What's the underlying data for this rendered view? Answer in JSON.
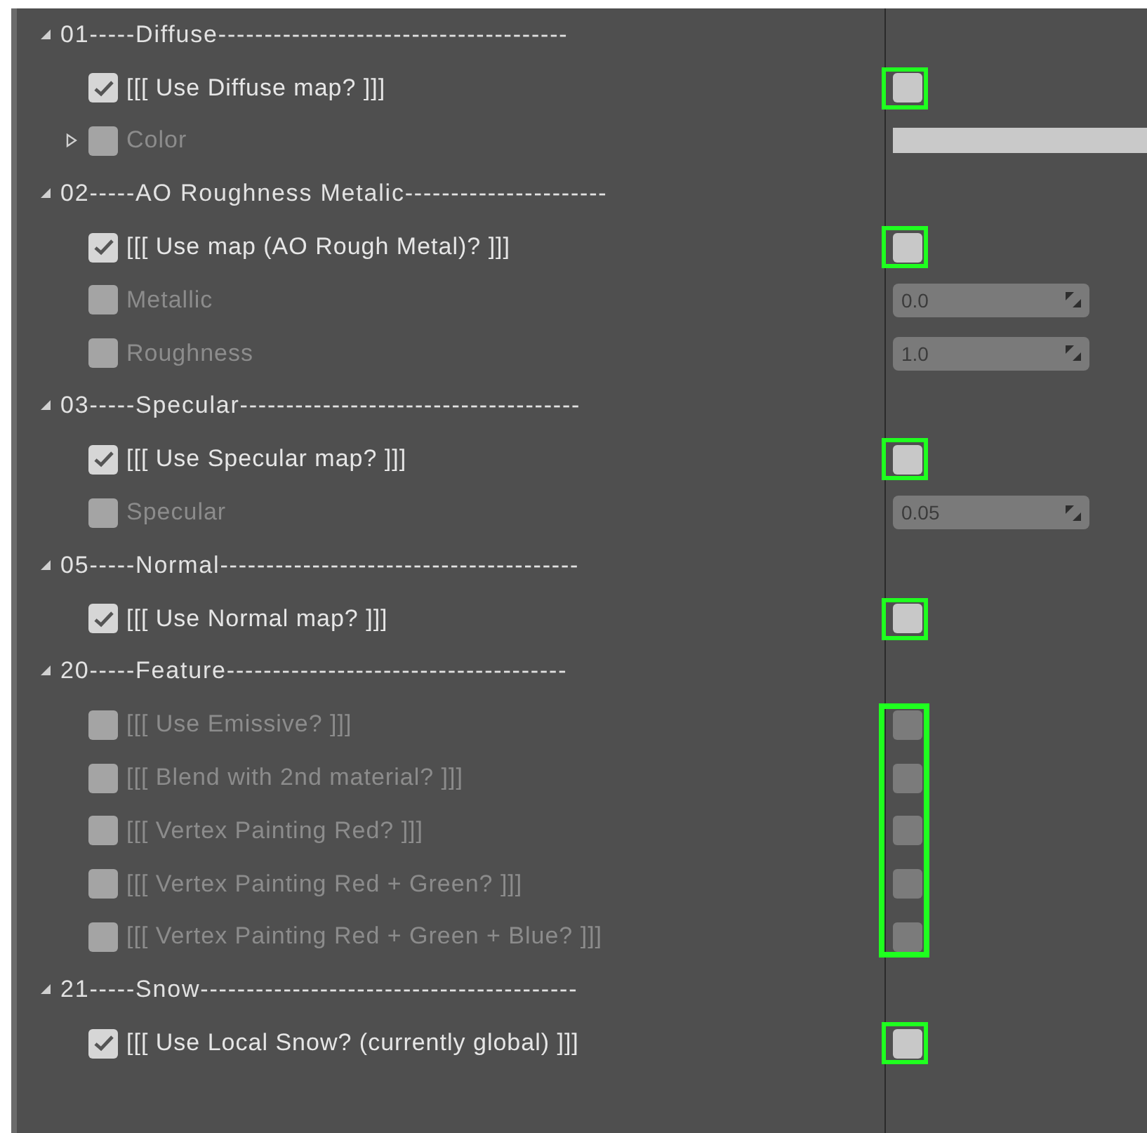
{
  "sections": [
    {
      "title": "01-----Diffuse--------------------------------------",
      "expanded": true,
      "group_highlighted": false,
      "rows": [
        {
          "label": "[[[ Use Diffuse map? ]]]",
          "override": true,
          "expandable": false,
          "control": {
            "kind": "checkbox",
            "checked": false,
            "disabled": false,
            "highlighted": true
          }
        },
        {
          "label": "Color",
          "override": false,
          "expandable": true,
          "expanded": false,
          "control": {
            "kind": "color"
          }
        }
      ]
    },
    {
      "title": "02-----AO Roughness Metalic----------------------",
      "expanded": true,
      "group_highlighted": false,
      "rows": [
        {
          "label": "[[[ Use map (AO Rough Metal)? ]]]",
          "override": true,
          "expandable": false,
          "control": {
            "kind": "checkbox",
            "checked": false,
            "disabled": false,
            "highlighted": true
          }
        },
        {
          "label": "Metallic",
          "override": false,
          "expandable": false,
          "control": {
            "kind": "number",
            "value": "0.0"
          }
        },
        {
          "label": "Roughness",
          "override": false,
          "expandable": false,
          "control": {
            "kind": "number",
            "value": "1.0"
          }
        }
      ]
    },
    {
      "title": "03-----Specular-------------------------------------",
      "expanded": true,
      "group_highlighted": false,
      "rows": [
        {
          "label": "[[[ Use Specular map? ]]]",
          "override": true,
          "expandable": false,
          "control": {
            "kind": "checkbox",
            "checked": false,
            "disabled": false,
            "highlighted": true
          }
        },
        {
          "label": "Specular",
          "override": false,
          "expandable": false,
          "control": {
            "kind": "number",
            "value": "0.05"
          }
        }
      ]
    },
    {
      "title": "05-----Normal---------------------------------------",
      "expanded": true,
      "group_highlighted": false,
      "rows": [
        {
          "label": "[[[ Use Normal map? ]]]",
          "override": true,
          "expandable": false,
          "control": {
            "kind": "checkbox",
            "checked": false,
            "disabled": false,
            "highlighted": true
          }
        }
      ]
    },
    {
      "title": "20-----Feature-------------------------------------",
      "expanded": true,
      "group_highlighted": true,
      "rows": [
        {
          "label": "[[[ Use Emissive? ]]]",
          "override": false,
          "expandable": false,
          "control": {
            "kind": "checkbox",
            "checked": false,
            "disabled": true,
            "highlighted": false
          }
        },
        {
          "label": "[[[ Blend with 2nd material? ]]]",
          "override": false,
          "expandable": false,
          "control": {
            "kind": "checkbox",
            "checked": false,
            "disabled": true,
            "highlighted": false
          }
        },
        {
          "label": "[[[ Vertex Painting Red? ]]]",
          "override": false,
          "expandable": false,
          "control": {
            "kind": "checkbox",
            "checked": false,
            "disabled": true,
            "highlighted": false
          }
        },
        {
          "label": "[[[ Vertex Painting Red + Green? ]]]",
          "override": false,
          "expandable": false,
          "control": {
            "kind": "checkbox",
            "checked": false,
            "disabled": true,
            "highlighted": false
          }
        },
        {
          "label": "[[[ Vertex Painting Red + Green + Blue? ]]]",
          "override": false,
          "expandable": false,
          "control": {
            "kind": "checkbox",
            "checked": false,
            "disabled": true,
            "highlighted": false
          }
        }
      ]
    },
    {
      "title": "21-----Snow-----------------------------------------",
      "expanded": true,
      "group_highlighted": false,
      "rows": [
        {
          "label": "[[[ Use Local Snow? (currently global) ]]]",
          "override": true,
          "expandable": false,
          "control": {
            "kind": "checkbox",
            "checked": false,
            "disabled": false,
            "highlighted": true
          }
        }
      ]
    }
  ]
}
